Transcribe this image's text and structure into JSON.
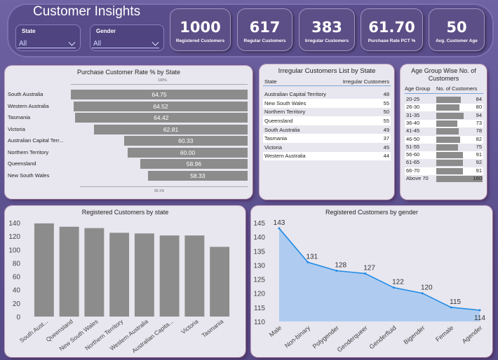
{
  "header": {
    "title": "Customer Insights",
    "slicers": [
      {
        "label": "State",
        "value": "All"
      },
      {
        "label": "Gender",
        "value": "All"
      }
    ],
    "kpis": [
      {
        "value": "1000",
        "caption": "Registered Customers"
      },
      {
        "value": "617",
        "caption": "Regular Customers"
      },
      {
        "value": "383",
        "caption": "Irregular Customers"
      },
      {
        "value": "61.70",
        "caption": "Purchase Rate PCT %"
      },
      {
        "value": "50",
        "caption": "Avg. Customer Age"
      }
    ]
  },
  "purchase_rate": {
    "title": "Purchase Customer Rate % by State",
    "top_ref": "100%",
    "bottom_ref": "90.1%"
  },
  "irregular_list": {
    "title": "Irregular Customers List by State",
    "columns": [
      "State",
      "Irregular Customers"
    ],
    "rows": [
      [
        "Australian Capital Territory",
        "48"
      ],
      [
        "New South Wales",
        "55"
      ],
      [
        "Northern Territory",
        "50"
      ],
      [
        "Queensland",
        "55"
      ],
      [
        "South Australia",
        "49"
      ],
      [
        "Tasmania",
        "37"
      ],
      [
        "Victoria",
        "45"
      ],
      [
        "Western Australia",
        "44"
      ]
    ]
  },
  "age_groups": {
    "title": "Age Group Wise No. of Customers",
    "columns": [
      "Age Group",
      "No. of Customers"
    ]
  },
  "registered_state": {
    "title": "Registered Customers by state"
  },
  "registered_gender": {
    "title": "Registered Customers by gender"
  },
  "chart_data": [
    {
      "type": "bar",
      "orientation": "horizontal",
      "title": "Purchase Customer Rate % by State",
      "categories": [
        "South Australia",
        "Western Australia",
        "Tasmania",
        "Victoria",
        "Australian Capital Terr...",
        "Northern Territory",
        "Queensland",
        "New South Wales"
      ],
      "values": [
        64.75,
        64.52,
        64.42,
        62.81,
        60.33,
        60.0,
        58.96,
        58.33
      ],
      "data_labels": [
        "64.75",
        "64.52",
        "64.42",
        "62.81",
        "60.33",
        "60.00",
        "58.96",
        "58.33"
      ],
      "color": "#8c8c8c"
    },
    {
      "type": "table",
      "title": "Age Group Wise No. of Customers",
      "categories": [
        "20-25",
        "26-30",
        "31-35",
        "36-40",
        "41-45",
        "46-50",
        "51-55",
        "56-60",
        "61-65",
        "66-70",
        "Above 70"
      ],
      "values": [
        84,
        80,
        94,
        73,
        78,
        82,
        75,
        91,
        92,
        91,
        160
      ]
    },
    {
      "type": "bar",
      "title": "Registered Customers by state",
      "categories": [
        "South Aust...",
        "Queensland",
        "New South Wales",
        "Northern Territory",
        "Western Australia",
        "Australian Capita...",
        "Victoria",
        "Tasmania"
      ],
      "values": [
        139,
        134,
        132,
        125,
        124,
        121,
        121,
        104
      ],
      "ylim": [
        0,
        140
      ],
      "yticks": [
        "0",
        "20",
        "40",
        "60",
        "80",
        "100",
        "120",
        "140"
      ],
      "grid": false,
      "color": "#8c8c8c"
    },
    {
      "type": "area",
      "title": "Registered Customers by gender",
      "categories": [
        "Male",
        "Non-binary",
        "Polygender",
        "Genderqueer",
        "Genderfluid",
        "Bigender",
        "Female",
        "Agender"
      ],
      "values": [
        143,
        131,
        128,
        127,
        122,
        120,
        115,
        114
      ],
      "data_labels": [
        "143",
        "131",
        "128",
        "127",
        "122",
        "120",
        "115",
        "114"
      ],
      "ylim": [
        110,
        145
      ],
      "yticks": [
        "110",
        "115",
        "120",
        "125",
        "130",
        "135",
        "140",
        "145"
      ],
      "line_color": "#1f8ae6",
      "fill_color": "#a9c9ef"
    }
  ]
}
